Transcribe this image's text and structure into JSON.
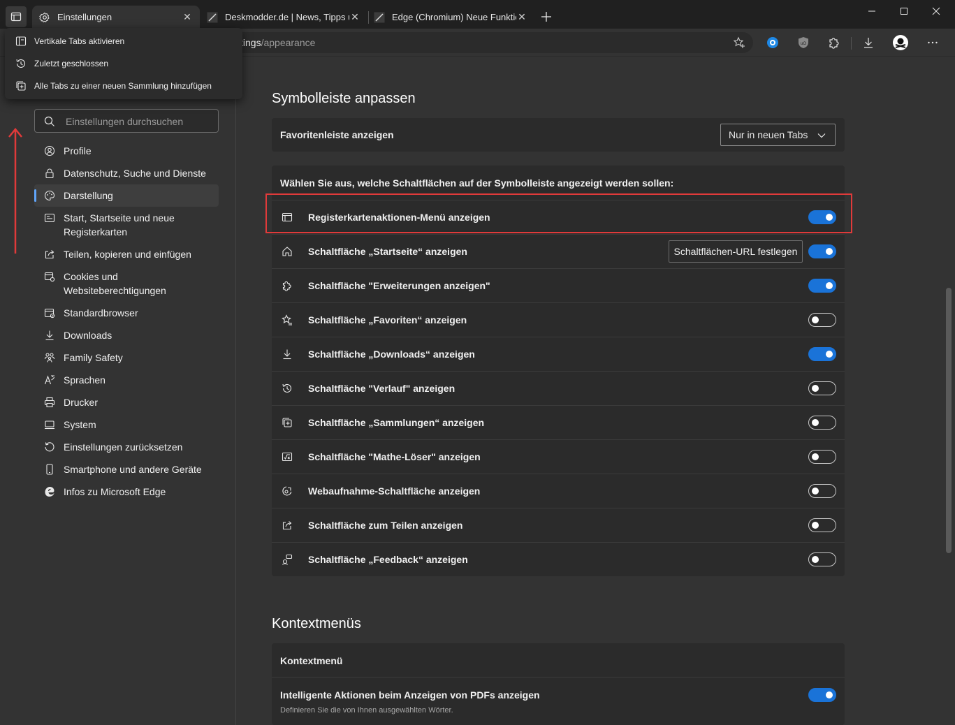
{
  "tabs": [
    {
      "title": "Einstellungen",
      "active": true
    },
    {
      "title": "Deskmodder.de | News, Tipps und"
    },
    {
      "title": "Edge (Chromium) Neue Funktion"
    }
  ],
  "address": {
    "url_prefix": "tings",
    "url_path": "/appearance"
  },
  "tab_menu": {
    "items": [
      {
        "label": "Vertikale Tabs aktivieren",
        "icon": "vertical-tabs-icon"
      },
      {
        "label": "Zuletzt geschlossen",
        "icon": "history-icon"
      },
      {
        "label": "Alle Tabs zu einer neuen Sammlung hinzufügen",
        "icon": "collections-icon"
      }
    ]
  },
  "sidebar": {
    "search_placeholder": "Einstellungen durchsuchen",
    "items": [
      {
        "label": "Profile",
        "icon": "profile-icon"
      },
      {
        "label": "Datenschutz, Suche und Dienste",
        "icon": "lock-icon"
      },
      {
        "label": "Darstellung",
        "icon": "palette-icon",
        "active": true
      },
      {
        "label": "Start, Startseite und neue Registerkarten",
        "icon": "start-icon"
      },
      {
        "label": "Teilen, kopieren und einfügen",
        "icon": "share-icon"
      },
      {
        "label": "Cookies und Websiteberechtigungen",
        "icon": "cookies-icon"
      },
      {
        "label": "Standardbrowser",
        "icon": "browser-icon"
      },
      {
        "label": "Downloads",
        "icon": "download-icon"
      },
      {
        "label": "Family Safety",
        "icon": "family-icon"
      },
      {
        "label": "Sprachen",
        "icon": "language-icon"
      },
      {
        "label": "Drucker",
        "icon": "printer-icon"
      },
      {
        "label": "System",
        "icon": "system-icon"
      },
      {
        "label": "Einstellungen zurücksetzen",
        "icon": "reset-icon"
      },
      {
        "label": "Smartphone und andere Geräte",
        "icon": "phone-icon"
      },
      {
        "label": "Infos zu Microsoft Edge",
        "icon": "edge-icon"
      }
    ]
  },
  "toolbar_section": {
    "title": "Symbolleiste anpassen",
    "favorites_bar_label": "Favoritenleiste anzeigen",
    "favorites_bar_value": "Nur in neuen Tabs",
    "buttons_header": "Wählen Sie aus, welche Schaltflächen auf der Symbolleiste angezeigt werden sollen:",
    "home_url_button": "Schaltflächen-URL festlegen",
    "options": [
      {
        "label": "Registerkartenaktionen-Menü anzeigen",
        "on": true
      },
      {
        "label": "Schaltfläche „Startseite“ anzeigen",
        "on": true
      },
      {
        "label": "Schaltfläche \"Erweiterungen anzeigen\"",
        "on": true
      },
      {
        "label": "Schaltfläche „Favoriten“ anzeigen",
        "on": false
      },
      {
        "label": "Schaltfläche „Downloads“ anzeigen",
        "on": true
      },
      {
        "label": "Schaltfläche \"Verlauf\" anzeigen",
        "on": false
      },
      {
        "label": "Schaltfläche „Sammlungen“ anzeigen",
        "on": false
      },
      {
        "label": "Schaltfläche \"Mathe-Löser\" anzeigen",
        "on": false
      },
      {
        "label": "Webaufnahme-Schaltfläche anzeigen",
        "on": false
      },
      {
        "label": "Schaltfläche zum Teilen anzeigen",
        "on": false
      },
      {
        "label": "Schaltfläche „Feedback“ anzeigen",
        "on": false
      }
    ]
  },
  "context_section": {
    "title": "Kontextmenüs",
    "card_title": "Kontextmenü",
    "option_label": "Intelligente Aktionen beim Anzeigen von PDFs anzeigen",
    "option_sub": "Definieren Sie die von Ihnen ausgewählten Wörter.",
    "option_on": true
  },
  "colors": {
    "accent": "#1a73d8",
    "highlight": "#e03a3a"
  }
}
